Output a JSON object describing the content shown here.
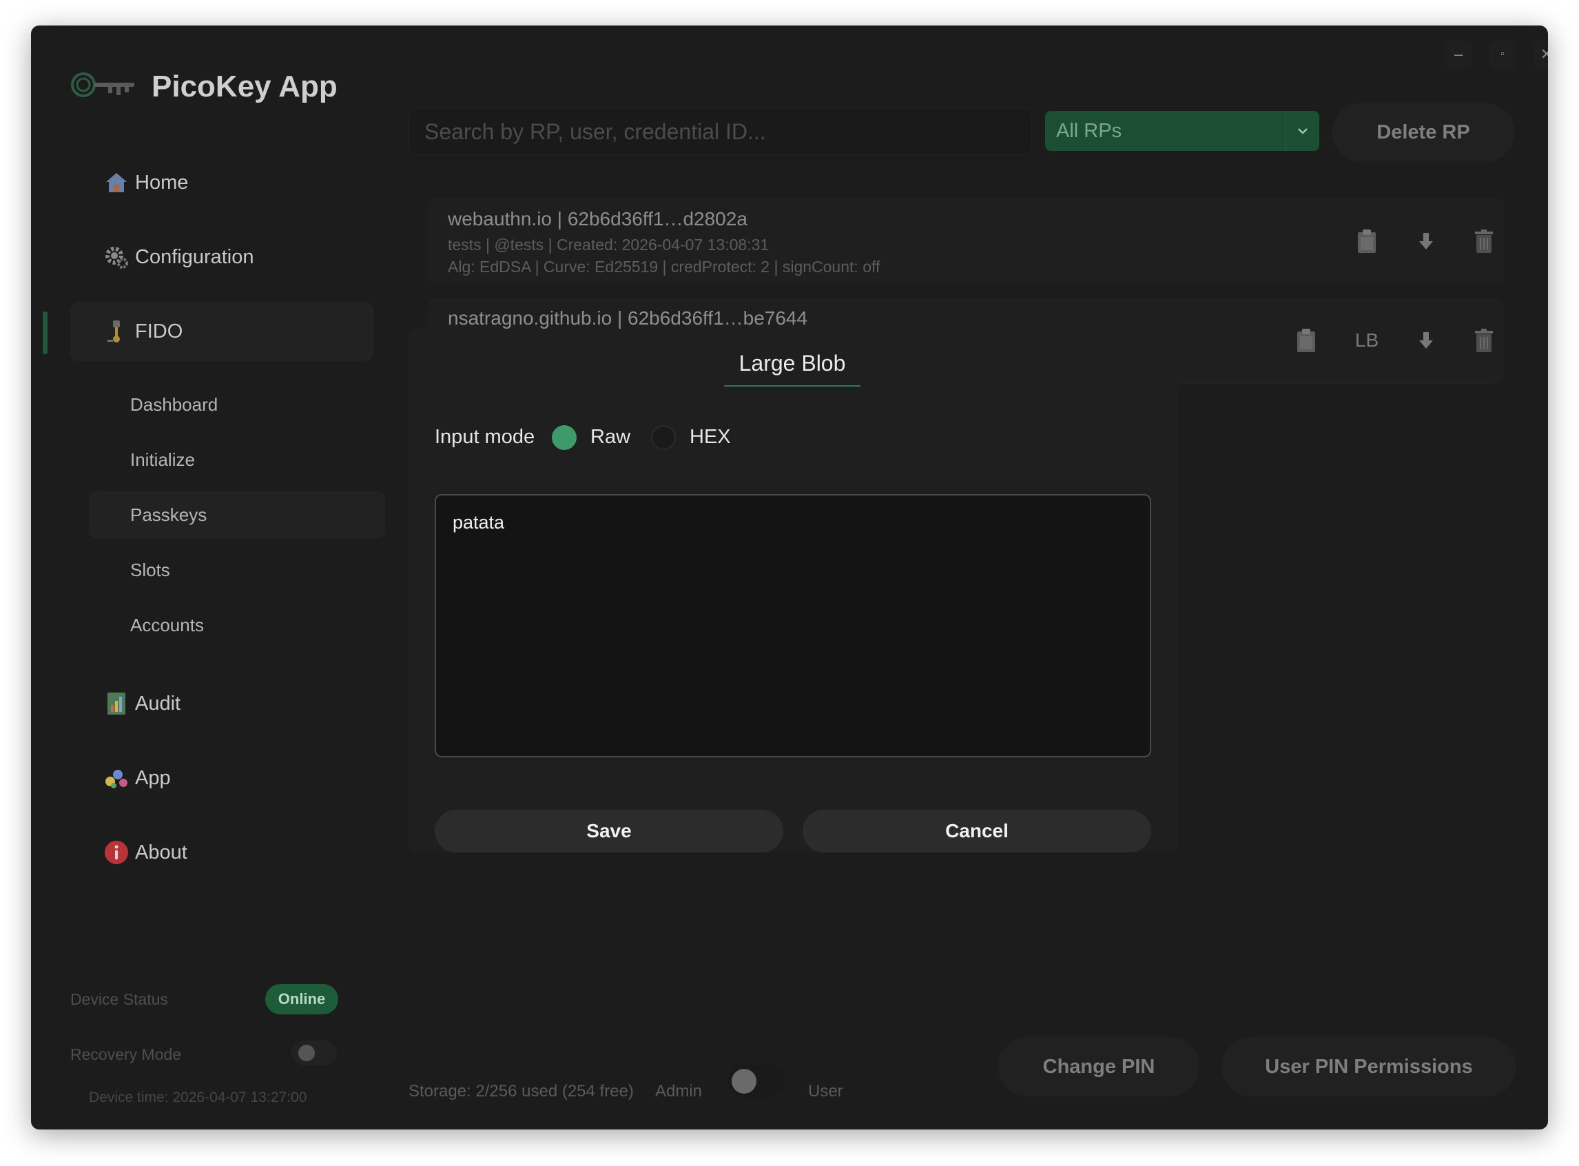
{
  "app": {
    "title": "PicoKey App"
  },
  "window_controls": {
    "minimize": "–",
    "maximize": "▫",
    "close": "✕"
  },
  "sidebar": {
    "nav": [
      {
        "label": "Home",
        "icon": "home-icon"
      },
      {
        "label": "Configuration",
        "icon": "gear-icon"
      },
      {
        "label": "FIDO",
        "icon": "key-icon",
        "active": true
      },
      {
        "label": "Audit",
        "icon": "audit-icon"
      },
      {
        "label": "App",
        "icon": "app-icon"
      },
      {
        "label": "About",
        "icon": "info-icon"
      }
    ],
    "fido_sub": [
      "Dashboard",
      "Initialize",
      "Passkeys",
      "Slots",
      "Accounts"
    ],
    "fido_sub_active": "Passkeys",
    "device_status_label": "Device Status",
    "device_status_value": "Online",
    "recovery_mode_label": "Recovery Mode",
    "recovery_mode_on": false,
    "device_time": "Device time: 2026-04-07 13:27:00"
  },
  "toolbar": {
    "search_placeholder": "Search by RP, user, credential ID...",
    "rp_filter": "All RPs",
    "delete_rp": "Delete RP"
  },
  "credentials": [
    {
      "line1": "webauthn.io  |  62b6d36ff1…d2802a",
      "line2": "tests  |  @tests  |  Created: 2026-04-07 13:08:31",
      "line3": "Alg: EdDSA  |  Curve: Ed25519  |  credProtect: 2  |  signCount: off"
    },
    {
      "line1": "nsatragno.github.io  |  62b6d36ff1…be7644",
      "lb_label": "LB"
    }
  ],
  "footer": {
    "storage": "Storage: 2/256 used (254 free)",
    "admin_label": "Admin",
    "user_label": "User",
    "change_pin": "Change PIN",
    "user_pin_permissions": "User PIN Permissions"
  },
  "dialog": {
    "tab": "Large Blob",
    "input_mode_label": "Input mode",
    "options": [
      "Raw",
      "HEX"
    ],
    "selected": "Raw",
    "value": "patata",
    "save": "Save",
    "cancel": "Cancel"
  },
  "colors": {
    "accent": "#3f9a6a",
    "online_badge": "#1d5c38",
    "window_bg": "#1c1c1c"
  }
}
